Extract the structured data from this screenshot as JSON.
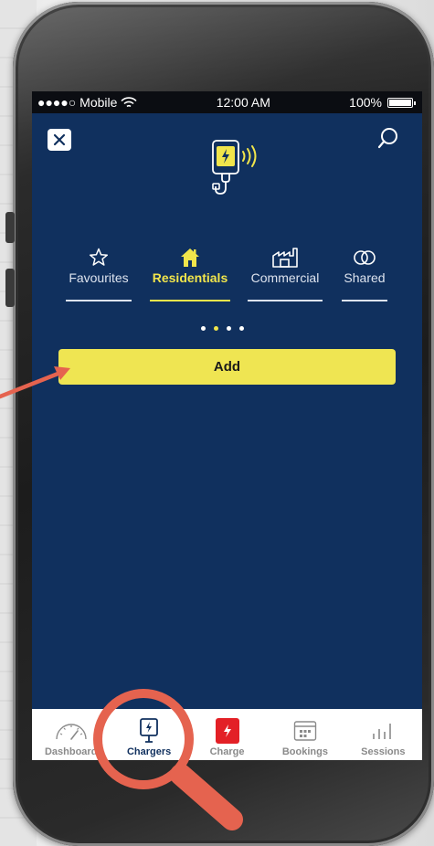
{
  "status_bar": {
    "carrier": "●●●●○ Mobile",
    "time": "12:00 AM",
    "battery": "100%"
  },
  "header": {
    "close_icon": "close-icon",
    "search_icon": "search-icon",
    "hero_icon": "charger-wireless-icon"
  },
  "tabs": [
    {
      "label": "Favourites",
      "icon": "star-icon",
      "active": false
    },
    {
      "label": "Residentials",
      "icon": "house-icon",
      "active": true
    },
    {
      "label": "Commercial",
      "icon": "factory-icon",
      "active": false
    },
    {
      "label": "Shared",
      "icon": "rings-icon",
      "active": false
    }
  ],
  "pager": {
    "count": 4,
    "active_index": 1
  },
  "add_button": {
    "label": "Add"
  },
  "bottom_nav": [
    {
      "label": "Dashboard",
      "icon": "speedometer-icon",
      "active": false
    },
    {
      "label": "Chargers",
      "icon": "charger-icon",
      "active": true
    },
    {
      "label": "Charge",
      "icon": "bolt-icon",
      "active": false
    },
    {
      "label": "Bookings",
      "icon": "calendar-icon",
      "active": false
    },
    {
      "label": "Sessions",
      "icon": "bar-chart-icon",
      "active": false
    }
  ],
  "colors": {
    "screen_bg": "#10305e",
    "accent_yellow": "#f1e54b",
    "add_button": "#efe552",
    "charge_red": "#e32026",
    "annotation": "#e5634f"
  }
}
